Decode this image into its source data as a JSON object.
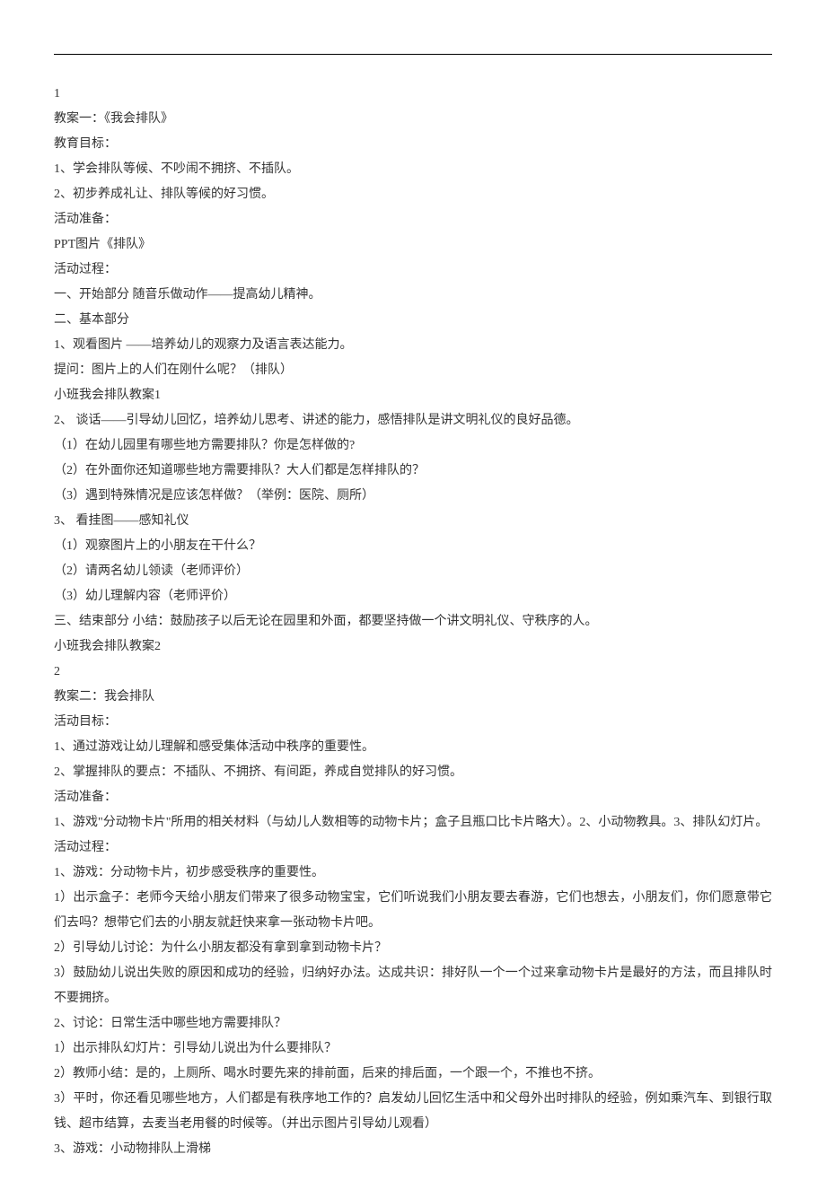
{
  "lines": [
    "1",
    "教案一：《我会排队》",
    "教育目标：",
    "1、学会排队等候、不吵闹不拥挤、不插队。",
    "2、初步养成礼让、排队等候的好习惯。",
    "活动准备：",
    "PPT图片《排队》",
    "活动过程：",
    "一、开始部分 随音乐做动作——提高幼儿精神。",
    "二、基本部分",
    "1、观看图片 ——培养幼儿的观察力及语言表达能力。",
    "提问：图片上的人们在刚什么呢？（排队）",
    "小班我会排队教案1",
    "2、 谈话——引导幼儿回忆，培养幼儿思考、讲述的能力，感悟排队是讲文明礼仪的良好品德。",
    "（1）在幼儿园里有哪些地方需要排队？你是怎样做的?",
    "（2）在外面你还知道哪些地方需要排队？大人们都是怎样排队的？",
    "（3）遇到特殊情况是应该怎样做？（举例：医院、厕所）",
    "3、 看挂图——感知礼仪",
    "（1）观察图片上的小朋友在干什么？",
    "（2）请两名幼儿领读（老师评价）",
    "（3）幼儿理解内容（老师评价）",
    "三、结束部分 小结：鼓励孩子以后无论在园里和外面，都要坚持做一个讲文明礼仪、守秩序的人。",
    "小班我会排队教案2",
    "2",
    "教案二：我会排队",
    "活动目标：",
    "1、通过游戏让幼儿理解和感受集体活动中秩序的重要性。",
    "2、掌握排队的要点：不插队、不拥挤、有间距，养成自觉排队的好习惯。",
    "活动准备：",
    "1、游戏\"分动物卡片\"所用的相关材料（与幼儿人数相等的动物卡片；盒子且瓶口比卡片略大）。2、小动物教具。3、排队幻灯片。",
    "活动过程：",
    "1、游戏：分动物卡片，初步感受秩序的重要性。",
    "1）出示盒子：老师今天给小朋友们带来了很多动物宝宝，它们听说我们小朋友要去春游，它们也想去，小朋友们，你们愿意带它们去吗？想带它们去的小朋友就赶快来拿一张动物卡片吧。",
    "2）引导幼儿讨论：为什么小朋友都没有拿到拿到动物卡片？",
    "3）鼓励幼儿说出失败的原因和成功的经验，归纳好办法。达成共识：排好队一个一个过来拿动物卡片是最好的方法，而且排队时不要拥挤。",
    "2、讨论：日常生活中哪些地方需要排队？",
    "1）出示排队幻灯片：引导幼儿说出为什么要排队？",
    "2）教师小结：是的，上厕所、喝水时要先来的排前面，后来的排后面，一个跟一个，不推也不挤。",
    "3）平时，你还看见哪些地方，人们都是有秩序地工作的？启发幼儿回忆生活中和父母外出时排队的经验，例如乘汽车、到银行取钱、超市结算，去麦当老用餐的时候等。（并出示图片引导幼儿观看）",
    "3、游戏：小动物排队上滑梯"
  ]
}
